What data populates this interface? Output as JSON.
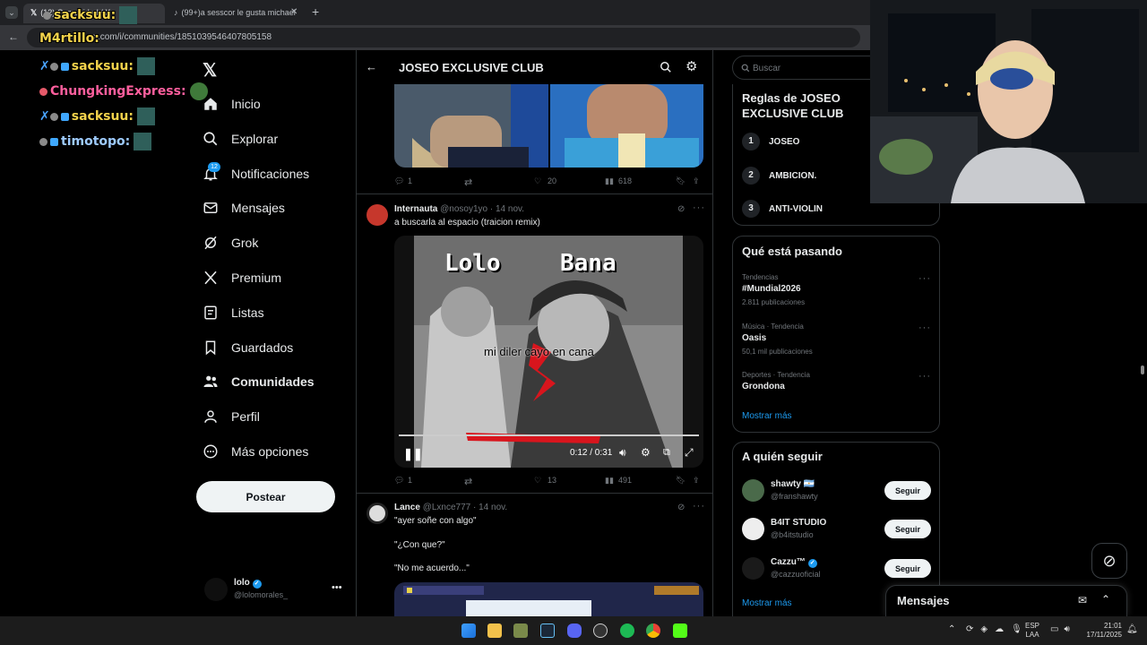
{
  "browser": {
    "tab1_title": "(12) Comunidad / X",
    "tab2_title": "(99+)a sesscor le gusta michael",
    "new_tab": "+",
    "url": "x.com/i/communities/1851039546407805158"
  },
  "chat_overlay": [
    {
      "user": "sacksuu:",
      "color": "#f2d24b"
    },
    {
      "user": "M4rtillo:",
      "color": "#f2d24b"
    },
    {
      "user": "sacksuu:",
      "color": "#f2d24b"
    },
    {
      "user": "ChungkingExpress:",
      "color": "#ff5f9e"
    },
    {
      "user": "sacksuu:",
      "color": "#f2d24b"
    },
    {
      "user": "timotopo:",
      "color": "#9ecbff"
    }
  ],
  "sidebar": {
    "items": [
      {
        "label": "Inicio",
        "icon": "home-icon"
      },
      {
        "label": "Explorar",
        "icon": "search-icon"
      },
      {
        "label": "Notificaciones",
        "icon": "bell-icon",
        "badge": "12"
      },
      {
        "label": "Mensajes",
        "icon": "mail-icon"
      },
      {
        "label": "Grok",
        "icon": "grok-icon"
      },
      {
        "label": "Premium",
        "icon": "x-logo-icon"
      },
      {
        "label": "Listas",
        "icon": "list-icon"
      },
      {
        "label": "Guardados",
        "icon": "bookmark-icon"
      },
      {
        "label": "Comunidades",
        "icon": "people-icon"
      },
      {
        "label": "Perfil",
        "icon": "person-icon"
      },
      {
        "label": "Más opciones",
        "icon": "more-circle-icon"
      }
    ],
    "post_button": "Postear",
    "account_name": "lolo",
    "account_handle": "@lolomorales_"
  },
  "community": {
    "title": "JOSEO EXCLUSIVE CLUB"
  },
  "posts": [
    {
      "replies": "1",
      "likes": "20",
      "views": "618"
    },
    {
      "author": "Internauta",
      "handle": "@nosoy1yo",
      "date": "· 14 nov.",
      "text": "a buscarla al espacio (traicion remix)",
      "video_labels": [
        "Lolo",
        "Bana"
      ],
      "video_caption": "mi diler cayo en cana",
      "video_time": "0:12 / 0:31",
      "replies": "1",
      "likes": "13",
      "views": "491"
    },
    {
      "author": "Lance",
      "handle": "@Lxnce777",
      "date": "· 14 nov.",
      "lines": [
        "\"ayer soñe con algo\"",
        "\"¿Con que?\"",
        "\"No me acuerdo...\""
      ]
    }
  ],
  "right": {
    "search_placeholder": "Buscar",
    "rules_title": "Reglas de JOSEO EXCLUSIVE CLUB",
    "rules": [
      {
        "n": "1",
        "text": "JOSEO"
      },
      {
        "n": "2",
        "text": "AMBICION."
      },
      {
        "n": "3",
        "text": "ANTI-VIOLIN"
      }
    ],
    "trends_title": "Qué está pasando",
    "trends": [
      {
        "sub": "Tendencias",
        "name": "#Mundial2026",
        "count": "2.811 publicaciones"
      },
      {
        "sub": "Música · Tendencia",
        "name": "Oasis",
        "count": "50,1 mil publicaciones"
      },
      {
        "sub": "Deportes · Tendencia",
        "name": "Grondona",
        "count": ""
      }
    ],
    "show_more": "Mostrar más",
    "follow_title": "A quién seguir",
    "follow": [
      {
        "name": "shawty 🇦🇷",
        "handle": "@franshawty"
      },
      {
        "name": "B4IT STUDIO",
        "handle": "@b4itstudio"
      },
      {
        "name": "Cazzu™",
        "handle": "@cazzuoficial"
      }
    ],
    "follow_button": "Seguir",
    "follow_more": "Mostrar más"
  },
  "messages_drawer": {
    "title": "Mensajes"
  },
  "taskbar": {
    "lang": "ESP",
    "lang2": "LAA",
    "time": "21:01",
    "date": "17/11/2025"
  },
  "colors": {
    "accent": "#1d9bf0",
    "background": "#000000",
    "border": "#2f3336"
  }
}
